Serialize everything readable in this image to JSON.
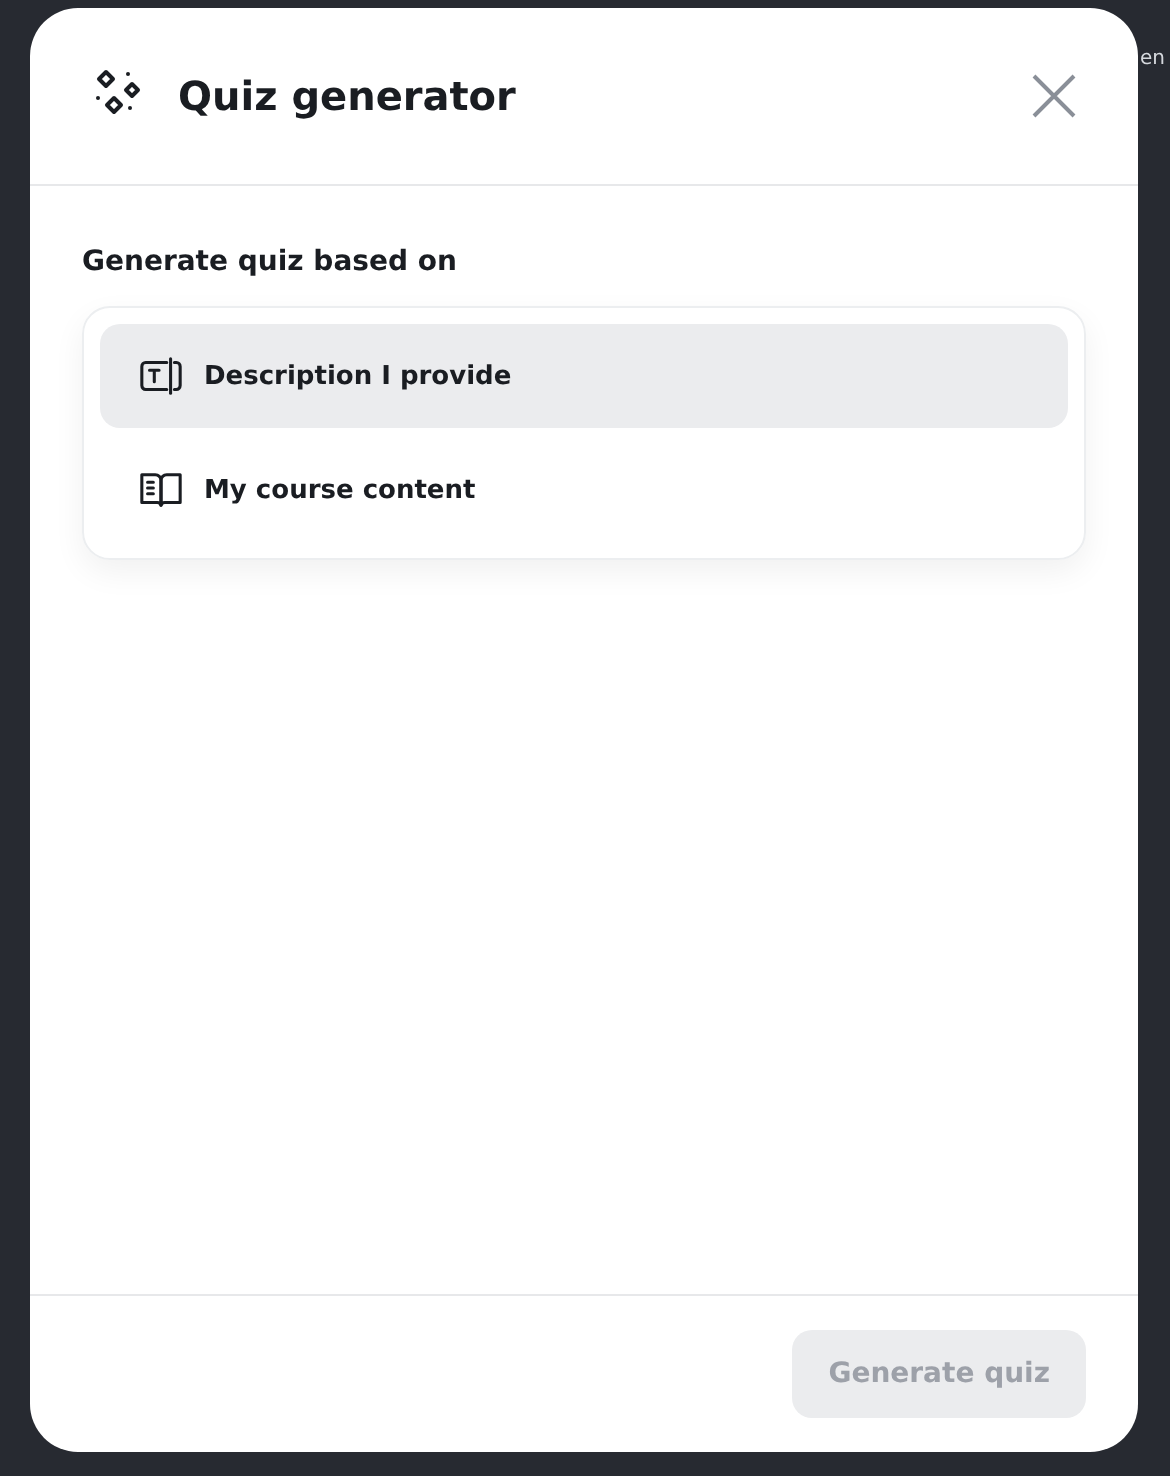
{
  "background": {
    "text_fragment": "en"
  },
  "dialog": {
    "title": "Quiz generator",
    "section_label": "Generate quiz based on",
    "options": [
      {
        "label": "Description I provide",
        "kind": "description",
        "selected": true
      },
      {
        "label": "My course content",
        "kind": "course",
        "selected": false
      }
    ],
    "primary_button": {
      "label": "Generate quiz",
      "disabled": true
    }
  }
}
